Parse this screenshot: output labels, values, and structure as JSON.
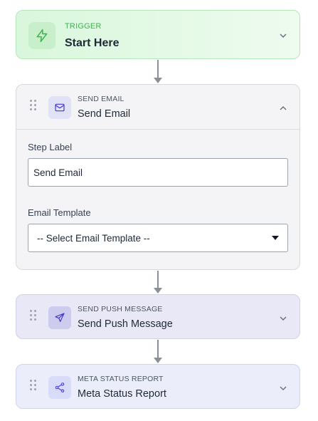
{
  "trigger": {
    "eyebrow": "TRIGGER",
    "title": "Start Here",
    "icon": "lightning-icon"
  },
  "send_email": {
    "eyebrow": "SEND EMAIL",
    "title": "Send Email",
    "icon": "envelope-icon",
    "step_label": {
      "label": "Step Label",
      "value": "Send Email"
    },
    "email_template": {
      "label": "Email Template",
      "selected": "-- Select Email Template --"
    }
  },
  "send_push": {
    "eyebrow": "SEND PUSH MESSAGE",
    "title": "Send Push Message",
    "icon": "paper-plane-icon"
  },
  "meta_status": {
    "eyebrow": "META STATUS REPORT",
    "title": "Meta Status Report",
    "icon": "share-nodes-icon"
  },
  "colors": {
    "trigger_accent": "#3fb34f",
    "email_accent": "#4338ca",
    "push_accent": "#4338ca",
    "meta_accent": "#4f46e5"
  }
}
